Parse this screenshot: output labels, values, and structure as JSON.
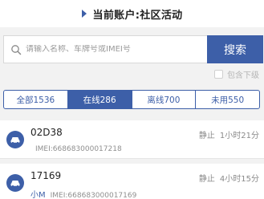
{
  "header": {
    "title": "当前账户:社区活动"
  },
  "search": {
    "placeholder": "请输入名称、车牌号或IMEI号",
    "button_label": "搜索",
    "include_sub_label": "包含下级"
  },
  "tabs": [
    {
      "label": "全部1536",
      "active": false
    },
    {
      "label": "在线286",
      "active": true
    },
    {
      "label": "离线700",
      "active": false
    },
    {
      "label": "未用550",
      "active": false
    }
  ],
  "devices": [
    {
      "name": "02D38",
      "status": "静止",
      "duration": "1小时21分",
      "alias": "",
      "imei": "IMEI:668683000017218"
    },
    {
      "name": "17169",
      "status": "静止",
      "duration": "4小时15分",
      "alias": "小M",
      "imei": "IMEI:668683000017169"
    }
  ],
  "colors": {
    "accent": "#3d5fa8"
  }
}
